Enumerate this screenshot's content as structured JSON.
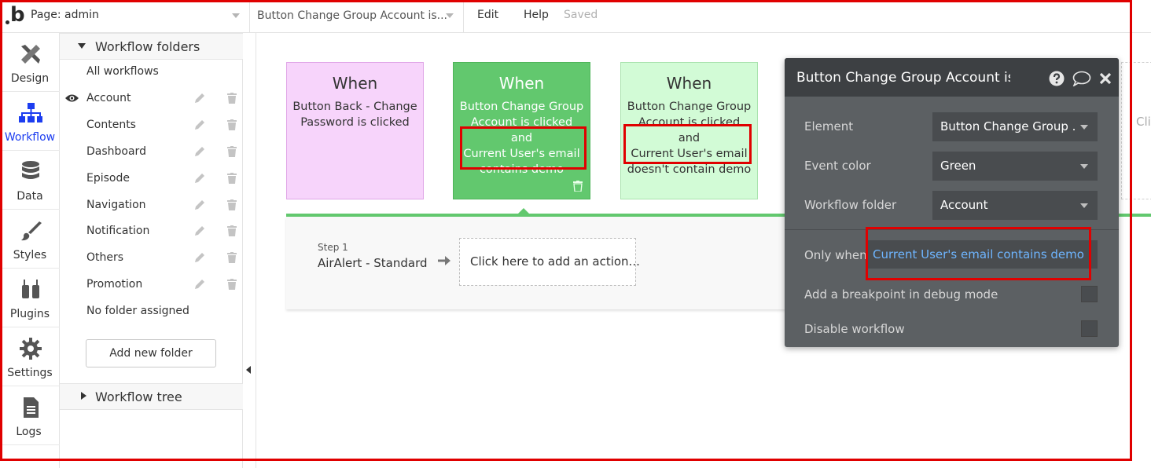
{
  "topbar": {
    "page_select": "Page: admin",
    "workflow_select": "Button Change Group Account is...",
    "menu": [
      "Edit",
      "Help"
    ],
    "status": "Saved"
  },
  "leftnav": {
    "items": [
      {
        "label": "Design",
        "icon": "design-icon"
      },
      {
        "label": "Workflow",
        "icon": "workflow-icon",
        "active": true
      },
      {
        "label": "Data",
        "icon": "database-icon"
      },
      {
        "label": "Styles",
        "icon": "brush-icon"
      },
      {
        "label": "Plugins",
        "icon": "plug-icon"
      },
      {
        "label": "Settings",
        "icon": "gear-icon"
      },
      {
        "label": "Logs",
        "icon": "document-icon"
      }
    ]
  },
  "folders": {
    "title": "Workflow folders",
    "all": "All workflows",
    "items": [
      "Account",
      "Contents",
      "Dashboard",
      "Episode",
      "Navigation",
      "Notification",
      "Others",
      "Promotion"
    ],
    "unassigned": "No folder assigned",
    "add_button": "Add new folder",
    "tree_title": "Workflow tree"
  },
  "events": [
    {
      "when": "When",
      "text": "Button Back - Change Password is clicked",
      "color": "#f7d4fb"
    },
    {
      "when": "When",
      "text_1": "Button Change Group Account is clicked and",
      "text_2": "Current User's email contains demo",
      "color": "#62c86e"
    },
    {
      "when": "When",
      "text_1": "Button Change Group Account is clicked and",
      "text_2": "Current User's email doesn't contain demo",
      "color": "#d2fbd6"
    }
  ],
  "step": {
    "label": "Step 1",
    "name": "AirAlert - Standard",
    "add_action": "Click here to add an action..."
  },
  "ghost_text": "Cli",
  "property_editor": {
    "title": "Button Change Group Account is c",
    "element_label": "Element",
    "element_value": "Button Change Group ...",
    "event_color_label": "Event color",
    "event_color_value": "Green",
    "folder_label": "Workflow folder",
    "folder_value": "Account",
    "only_when_label": "Only when",
    "only_when_value": "Current User's email contains demo",
    "breakpoint_label": "Add a breakpoint in debug mode",
    "disable_label": "Disable workflow"
  },
  "colors": {
    "accent": "#1c3df0",
    "event_green": "#62c86e",
    "annotation_red": "#e00000",
    "panel_dark": "#5c6063",
    "link_blue": "#6eb5ff"
  }
}
